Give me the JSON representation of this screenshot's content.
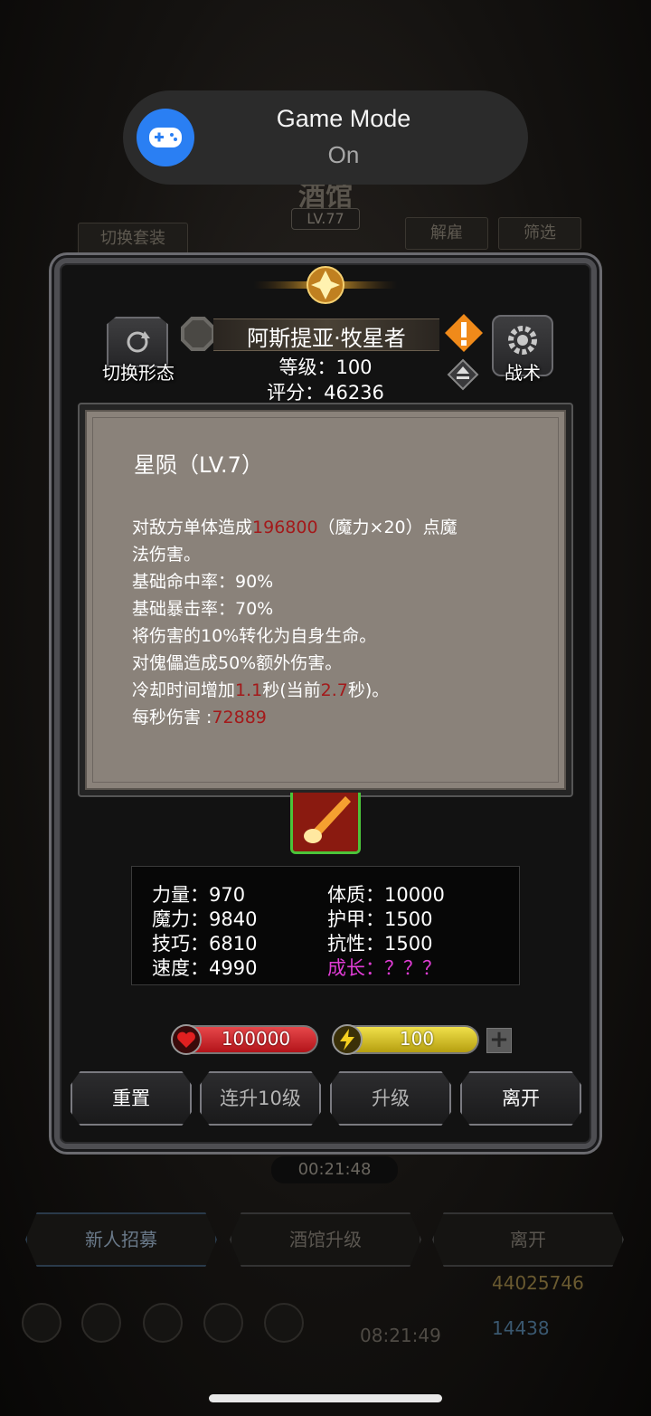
{
  "background": {
    "title": "酒馆",
    "level": "LV.77",
    "switch_outfit": "切换套装",
    "dismiss": "解雇",
    "filter": "筛选",
    "timer": "00:21:48",
    "tabs": [
      "新人招募",
      "酒馆升级",
      "离开"
    ],
    "coins": "44025746",
    "gems": "14438",
    "clock": "08:21:49"
  },
  "toast": {
    "title": "Game Mode",
    "status": "On"
  },
  "hero": {
    "switch_form": "切换形态",
    "tactics": "战术",
    "name": "阿斯提亚·牧星者",
    "level_line": "等级：100",
    "score_line": "评分：46236"
  },
  "skill": {
    "title": "星陨（LV.7）",
    "desc1_pre": "对敌方单体造成",
    "desc1_value": "196800",
    "desc1_post": "（魔力×20）点魔",
    "desc2": "法伤害。",
    "hit_rate": "基础命中率：90%",
    "crit_rate": "基础暴击率：70%",
    "lifesteal": "将伤害的10%转化为自身生命。",
    "bonus": "对傀儡造成50%额外伤害。",
    "cd_pre": "冷却时间增加",
    "cd_add": "1.1",
    "cd_mid": "秒(当前",
    "cd_cur": "2.7",
    "cd_post": "秒)。",
    "dps_label": "每秒伤害 :",
    "dps_value": "72889"
  },
  "attributes": {
    "strength": "力量：970",
    "magic": "魔力：9840",
    "skill": "技巧：6810",
    "speed": "速度：4990",
    "constitution": "体质：10000",
    "armor": "护甲：1500",
    "resistance": "抗性：1500",
    "growth": "成长：？？？"
  },
  "bars": {
    "hp": "100000",
    "energy": "100",
    "plus": "+"
  },
  "actions": {
    "reset": "重置",
    "level10": "连升10级",
    "levelup": "升级",
    "leave": "离开"
  },
  "colors": {
    "highlight": "#a3191a",
    "growth": "#e03cd5",
    "toast_icon": "#2a7ff3"
  }
}
